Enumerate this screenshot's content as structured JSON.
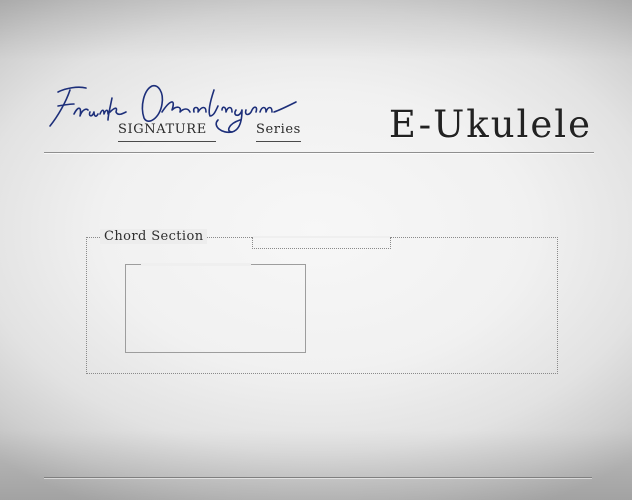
{
  "brand": {
    "signature_name": "Frank Oberlinger",
    "signature_word": "SIGNATURE",
    "series_word": "Series",
    "signature_color": "#1d2f7a"
  },
  "header": {
    "title": "E-Ukulele"
  },
  "chord_section": {
    "label": "Chord Section"
  }
}
